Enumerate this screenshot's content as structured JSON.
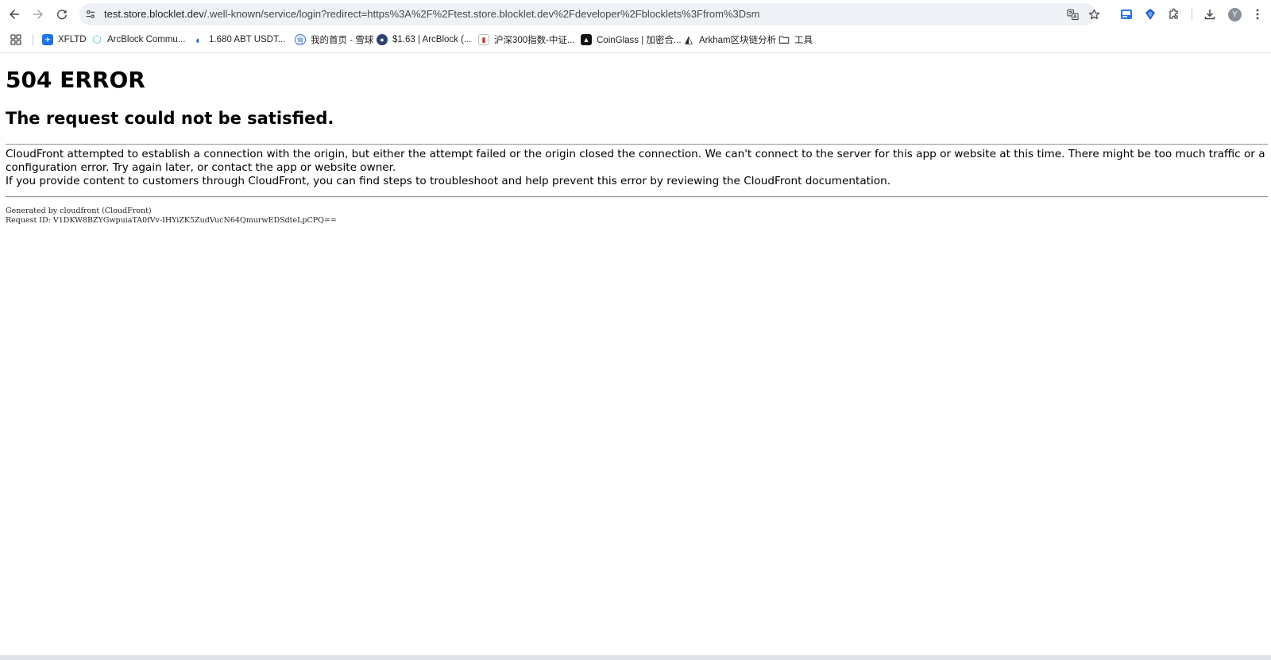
{
  "browser": {
    "url_host": "test.store.blocklet.dev",
    "url_path": "/.well-known/service/login?redirect=https%3A%2F%2Ftest.store.blocklet.dev%2Fdeveloper%2Fblocklets%3Ffrom%3Dsm",
    "avatar_initial": "Y",
    "icons": {
      "back": "back-arrow-icon",
      "forward": "forward-arrow-icon",
      "reload": "reload-icon",
      "site_info": "site-info-icon",
      "translate": "translate-icon",
      "bookmark": "star-icon",
      "extensions": "puzzle-icon",
      "downloads": "download-icon",
      "menu": "kebab-menu-icon"
    }
  },
  "bookmarks": [
    {
      "label": "XFLTD",
      "icon": "xfltd-favicon",
      "color": "#1a73e8"
    },
    {
      "label": "ArcBlock Commu...",
      "icon": "arcblock-favicon",
      "color": "#4fc3d9"
    },
    {
      "label": "1.680 ABT USDT...",
      "icon": "exchange-favicon",
      "color": "#1565c0"
    },
    {
      "label": "我的首页 - 雪球",
      "icon": "xueqiu-favicon",
      "color": "#3b6fd1"
    },
    {
      "label": "$1.63 | ArcBlock (...",
      "icon": "coingecko-favicon",
      "color": "#2f3f74"
    },
    {
      "label": "沪深300指数-中证...",
      "icon": "csindex-favicon",
      "color": "#d32f2f"
    },
    {
      "label": "CoinGlass | 加密合...",
      "icon": "coinglass-favicon",
      "color": "#111111"
    },
    {
      "label": "Arkham区块链分析",
      "icon": "arkham-favicon",
      "color": "#222222"
    },
    {
      "label": "工具",
      "icon": "folder-icon",
      "color": "#474747"
    }
  ],
  "error_page": {
    "code_heading": "504 ERROR",
    "title": "The request could not be satisfied.",
    "paragraph_1": "CloudFront attempted to establish a connection with the origin, but either the attempt failed or the origin closed the connection. We can't connect to the server for this app or website at this time. There might be too much traffic or a configuration error. Try again later, or contact the app or website owner.",
    "paragraph_2": "If you provide content to customers through CloudFront, you can find steps to troubleshoot and help prevent this error by reviewing the CloudFront documentation.",
    "generated_by": "Generated by cloudfront (CloudFront)",
    "request_id": "Request ID: V1DKW8BZYGwpuiaTA0fVv-IHYiZK5ZudVucN64QmurwEDSdteLpCPQ=="
  }
}
